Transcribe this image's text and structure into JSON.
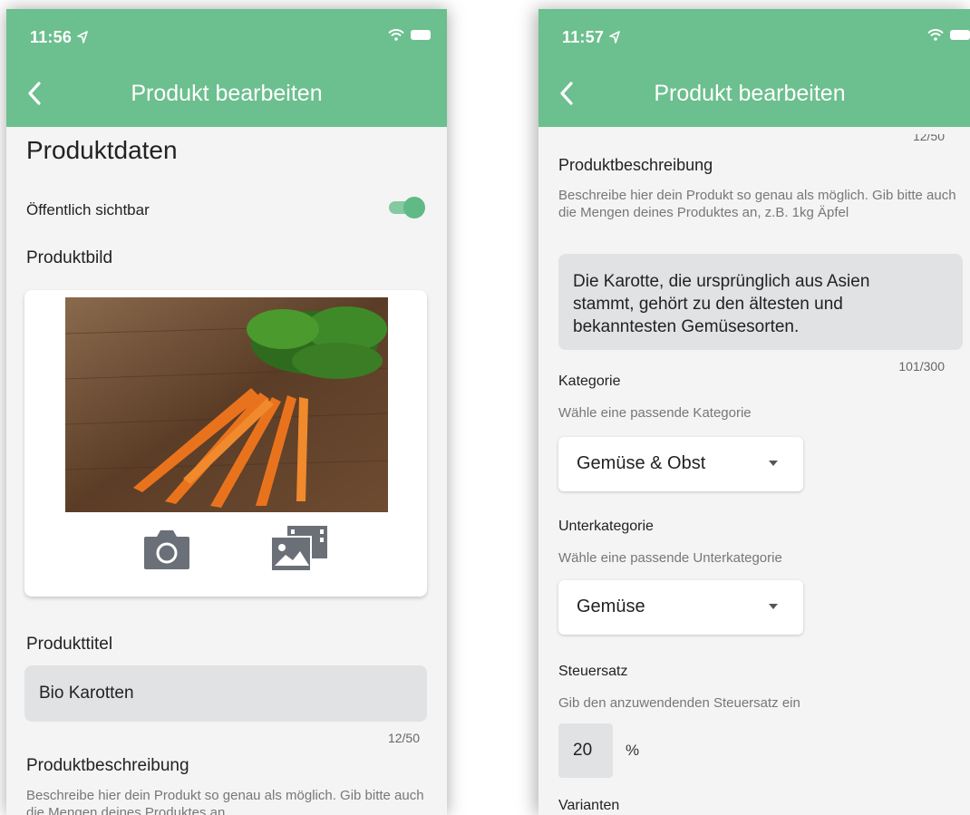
{
  "screen_left": {
    "status": {
      "time": "11:56"
    },
    "nav": {
      "title": "Produkt bearbeiten"
    },
    "heading": "Produktdaten",
    "visibility_label": "Öffentlich sichtbar",
    "visibility_on": true,
    "image_section": "Produktbild",
    "title_section": "Produkttitel",
    "title_value": "Bio Karotten",
    "title_counter": "12/50",
    "description_section": "Produktbeschreibung",
    "description_help": "Beschreibe hier dein Produkt so genau als möglich. Gib bitte auch die Mengen deines Produktes an."
  },
  "screen_right": {
    "status": {
      "time": "11:57"
    },
    "nav": {
      "title": "Produkt bearbeiten"
    },
    "prev_counter": "12/50",
    "description_section": "Produktbeschreibung",
    "description_help": "Beschreibe hier dein Produkt so genau als möglich. Gib bitte auch die Mengen deines Produktes an, z.B. 1kg Äpfel",
    "description_value": "Die Karotte, die ursprünglich aus Asien stammt, gehört zu den ältesten und bekanntesten Gemüsesorten.",
    "description_counter": "101/300",
    "category_section": "Kategorie",
    "category_help": "Wähle eine passende Kategorie",
    "category_value": "Gemüse & Obst",
    "subcategory_section": "Unterkategorie",
    "subcategory_help": "Wähle eine passende Unterkategorie",
    "subcategory_value": "Gemüse",
    "tax_section": "Steuersatz",
    "tax_help": "Gib den anzuwendenden Steuersatz ein",
    "tax_value": "20",
    "tax_unit": "%",
    "variants_section": "Varianten"
  },
  "colors": {
    "accent": "#6cbf8e",
    "background": "#f4f4f4",
    "field": "#e1e2e4"
  }
}
